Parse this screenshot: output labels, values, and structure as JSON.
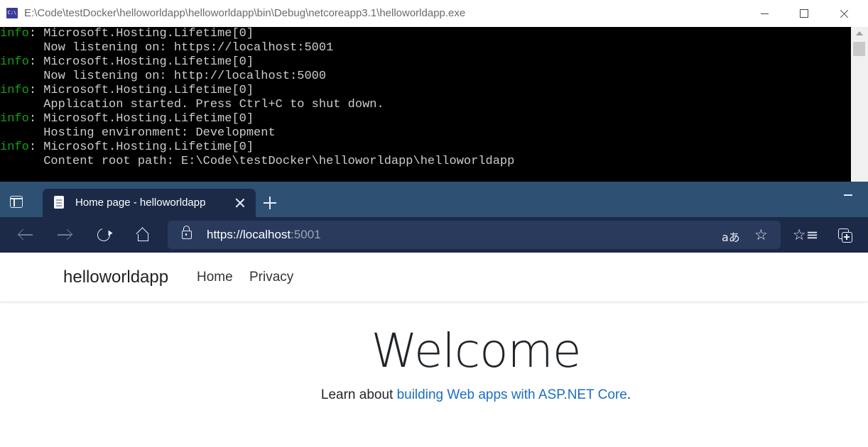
{
  "console": {
    "title": "E:\\Code\\testDocker\\helloworldapp\\helloworldapp\\bin\\Debug\\netcoreapp3.1\\helloworldapp.exe",
    "icon": "console-app-icon",
    "icon_text": "C:\\",
    "lines": [
      {
        "level": "info",
        "text": ": Microsoft.Hosting.Lifetime[0]"
      },
      {
        "level": "",
        "text": "      Now listening on: https://localhost:5001"
      },
      {
        "level": "info",
        "text": ": Microsoft.Hosting.Lifetime[0]"
      },
      {
        "level": "",
        "text": "      Now listening on: http://localhost:5000"
      },
      {
        "level": "info",
        "text": ": Microsoft.Hosting.Lifetime[0]"
      },
      {
        "level": "",
        "text": "      Application started. Press Ctrl+C to shut down."
      },
      {
        "level": "info",
        "text": ": Microsoft.Hosting.Lifetime[0]"
      },
      {
        "level": "",
        "text": "      Hosting environment: Development"
      },
      {
        "level": "info",
        "text": ": Microsoft.Hosting.Lifetime[0]"
      },
      {
        "level": "",
        "text": "      Content root path: E:\\Code\\testDocker\\helloworldapp\\helloworldapp"
      }
    ],
    "colors": {
      "background": "#000000",
      "text": "#cccccc",
      "info": "#13a10e"
    }
  },
  "browser": {
    "tab": {
      "title": "Home page - helloworldapp"
    },
    "address": {
      "host": "https://localhost",
      "port": ":5001"
    },
    "icons": {
      "tab_actions": "tab-actions-icon",
      "back": "back-arrow-icon",
      "forward": "forward-arrow-icon",
      "refresh": "refresh-icon",
      "home": "home-icon",
      "lock": "lock-icon",
      "translate": "translate-icon",
      "translate_glyph": "aあ",
      "add_favorite": "add-favorite-icon",
      "add_favorite_glyph": "☆",
      "favorites": "favorites-icon",
      "favorites_glyph": "☆≡",
      "collections": "collections-icon"
    },
    "colors": {
      "tabstrip": "#2d5073",
      "toolbar": "#1c2a48"
    }
  },
  "site": {
    "brand": "helloworldapp",
    "nav": [
      {
        "label": "Home"
      },
      {
        "label": "Privacy"
      }
    ],
    "heading": "Welcome",
    "lead_prefix": "Learn about ",
    "lead_link": "building Web apps with ASP.NET Core",
    "lead_suffix": ".",
    "link_color": "#1b6ec2"
  }
}
